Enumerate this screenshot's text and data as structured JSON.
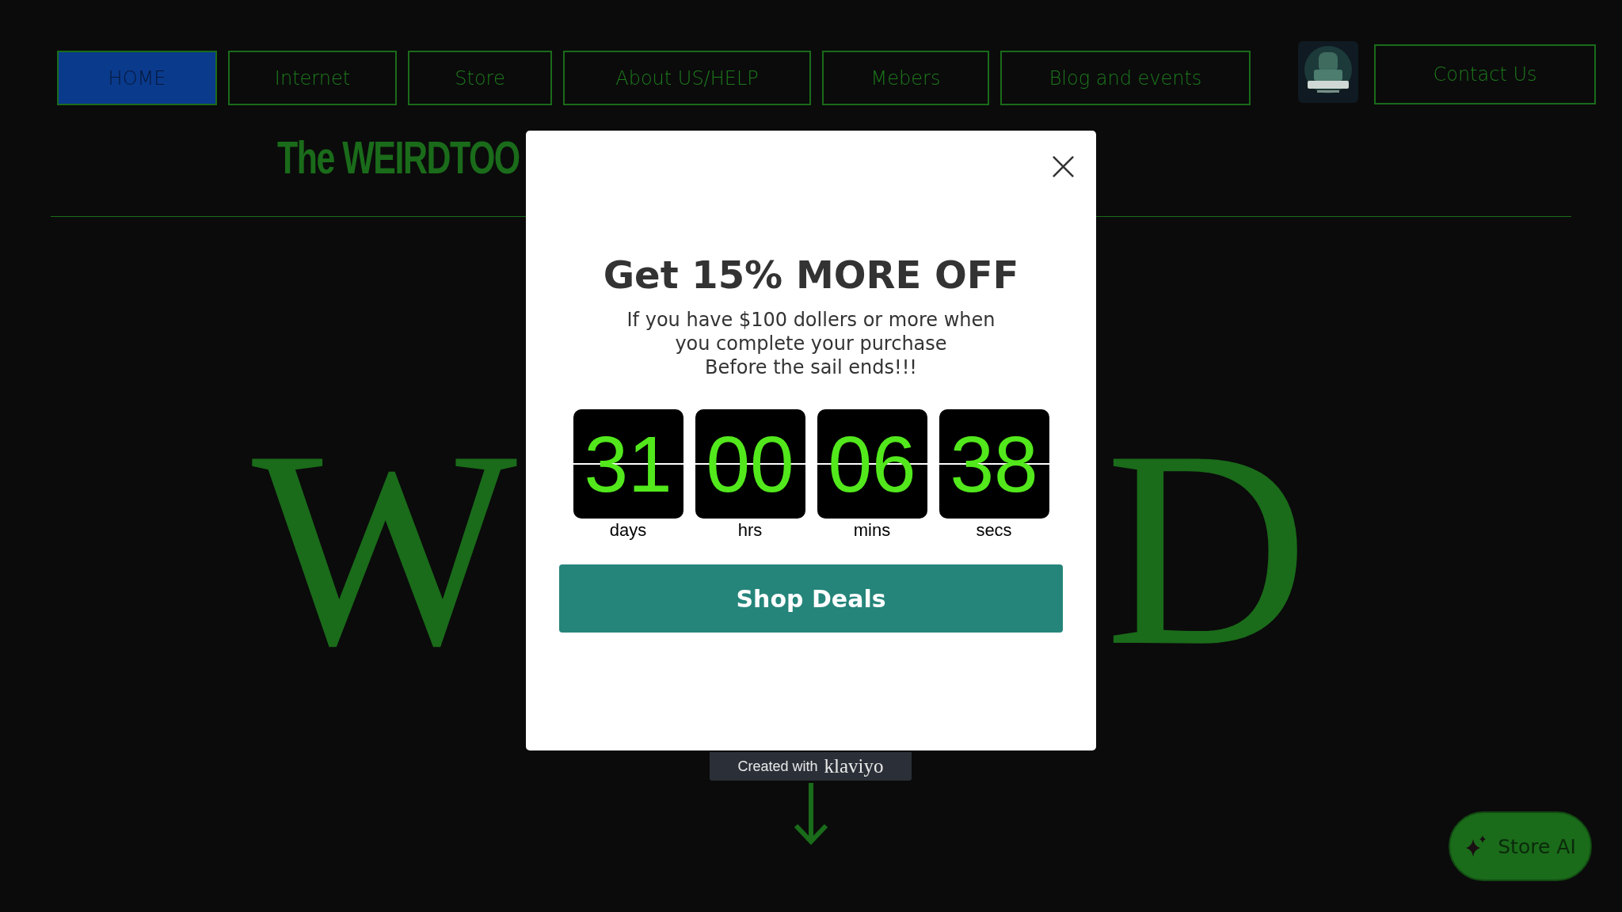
{
  "nav": {
    "items": [
      {
        "label": "HOME",
        "selected": true
      },
      {
        "label": "Internet",
        "selected": false
      },
      {
        "label": "Store",
        "selected": false
      },
      {
        "label": "About US/HELP",
        "selected": false
      },
      {
        "label": "Mebers",
        "selected": false
      },
      {
        "label": "Blog and events",
        "selected": false
      }
    ],
    "contact": "Contact Us"
  },
  "site_title": "The WEIRDTOO",
  "hero": {
    "letters": [
      "W",
      "D"
    ]
  },
  "popup": {
    "heading": "Get 15% MORE OFF",
    "body": [
      "If you have $100 dollers or more when",
      "you complete your purchase",
      "Before the sail ends!!!"
    ],
    "countdown": [
      {
        "value": "31",
        "unit": "days"
      },
      {
        "value": "00",
        "unit": "hrs"
      },
      {
        "value": "06",
        "unit": "mins"
      },
      {
        "value": "38",
        "unit": "secs"
      }
    ],
    "button": "Shop Deals"
  },
  "badge": {
    "prefix": "Created with",
    "brand": "klaviyo"
  },
  "assistant_button": "Store AI"
}
